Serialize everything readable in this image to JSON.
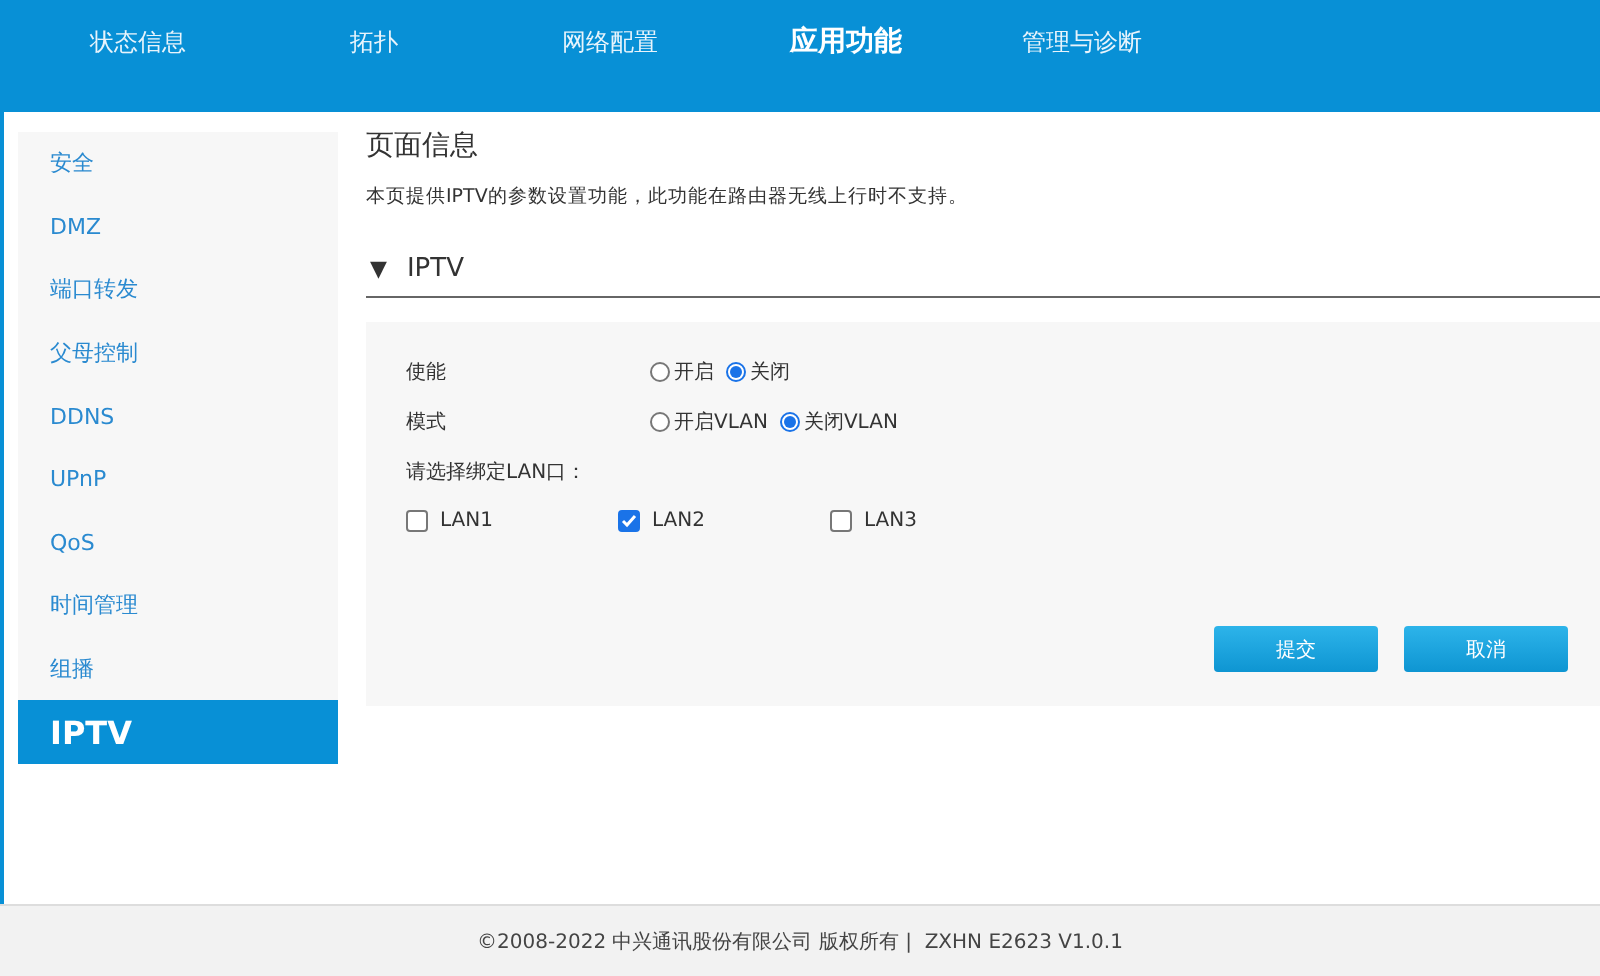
{
  "top_nav": [
    {
      "label": "状态信息",
      "selected": false
    },
    {
      "label": "拓扑",
      "selected": false
    },
    {
      "label": "网络配置",
      "selected": false
    },
    {
      "label": "应用功能",
      "selected": true
    },
    {
      "label": "管理与诊断",
      "selected": false
    }
  ],
  "sidebar": {
    "items": [
      {
        "label": "安全",
        "selected": false
      },
      {
        "label": "DMZ",
        "selected": false
      },
      {
        "label": "端口转发",
        "selected": false
      },
      {
        "label": "父母控制",
        "selected": false
      },
      {
        "label": "DDNS",
        "selected": false
      },
      {
        "label": "UPnP",
        "selected": false
      },
      {
        "label": "QoS",
        "selected": false
      },
      {
        "label": "时间管理",
        "selected": false
      },
      {
        "label": "组播",
        "selected": false
      },
      {
        "label": "IPTV",
        "selected": true
      }
    ]
  },
  "page": {
    "title": "页面信息",
    "description": "本页提供IPTV的参数设置功能，此功能在路由器无线上行时不支持。"
  },
  "section": {
    "toggle": "▼",
    "title": "IPTV",
    "expanded": true,
    "fields": [
      {
        "label": "使能",
        "options": [
          {
            "label": "开启",
            "selected": false
          },
          {
            "label": "关闭",
            "selected": true
          }
        ]
      },
      {
        "label": "模式",
        "options": [
          {
            "label": "开启VLAN",
            "selected": false
          },
          {
            "label": "关闭VLAN",
            "selected": true
          }
        ]
      }
    ],
    "lan_prompt": "请选择绑定LAN口：",
    "lans": [
      {
        "label": "LAN1",
        "checked": false
      },
      {
        "label": "LAN2",
        "checked": true
      },
      {
        "label": "LAN3",
        "checked": false
      }
    ],
    "buttons": [
      "提交",
      "取消"
    ]
  },
  "footer": "©2008-2022 中兴通讯股份有限公司 版权所有 |  ZXHN E2623 V1.0.1"
}
